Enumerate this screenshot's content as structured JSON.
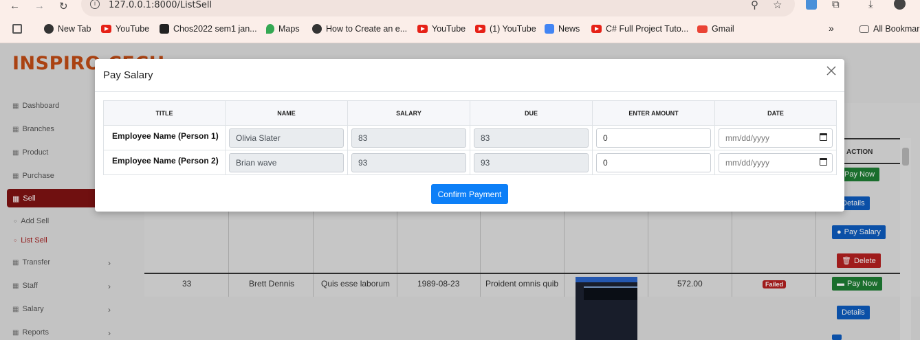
{
  "browser": {
    "url": "127.0.0.1:8000/ListSell",
    "bookmarks": [
      {
        "label": "New Tab"
      },
      {
        "label": "YouTube"
      },
      {
        "label": "Chos2022 sem1 jan..."
      },
      {
        "label": "Maps"
      },
      {
        "label": "How to Create an e..."
      },
      {
        "label": "YouTube"
      },
      {
        "label": "(1) YouTube"
      },
      {
        "label": "News"
      },
      {
        "label": "C# Full Project Tuto..."
      },
      {
        "label": "Gmail"
      }
    ],
    "more_chevron": "»",
    "all_bookmarks": "All Bookmar"
  },
  "app": {
    "brand": "INSPIRO CECH",
    "sidebar": [
      {
        "label": "Dashboard"
      },
      {
        "label": "Branches"
      },
      {
        "label": "Product"
      },
      {
        "label": "Purchase"
      },
      {
        "label": "Sell"
      },
      {
        "label": "Add Sell"
      },
      {
        "label": "List Sell"
      },
      {
        "label": "Transfer"
      },
      {
        "label": "Staff"
      },
      {
        "label": "Salary"
      },
      {
        "label": "Reports"
      }
    ],
    "table": {
      "action_header": "ACTION",
      "row": {
        "id": "33",
        "name": "Brett Dennis",
        "col3": "Quis esse laborum",
        "date": "1989-08-23",
        "col5": "Proident omnis quib",
        "amount": "572.00",
        "status": "Failed"
      },
      "actions": {
        "pay_now": "Pay Now",
        "details": "Details",
        "pay_salary": "Pay Salary",
        "delete": "Delete"
      }
    }
  },
  "modal": {
    "title": "Pay Salary",
    "columns": [
      "TITLE",
      "NAME",
      "SALARY",
      "DUE",
      "ENTER AMOUNT",
      "DATE"
    ],
    "rows": [
      {
        "title": "Employee Name (Person 1)",
        "name": "Olivia Slater",
        "salary": "83",
        "due": "83",
        "amount": "0",
        "date_placeholder": "mm/dd/yyyy"
      },
      {
        "title": "Employee Name (Person 2)",
        "name": "Brian wave",
        "salary": "93",
        "due": "93",
        "amount": "0",
        "date_placeholder": "mm/dd/yyyy"
      }
    ],
    "confirm_label": "Confirm Payment"
  }
}
